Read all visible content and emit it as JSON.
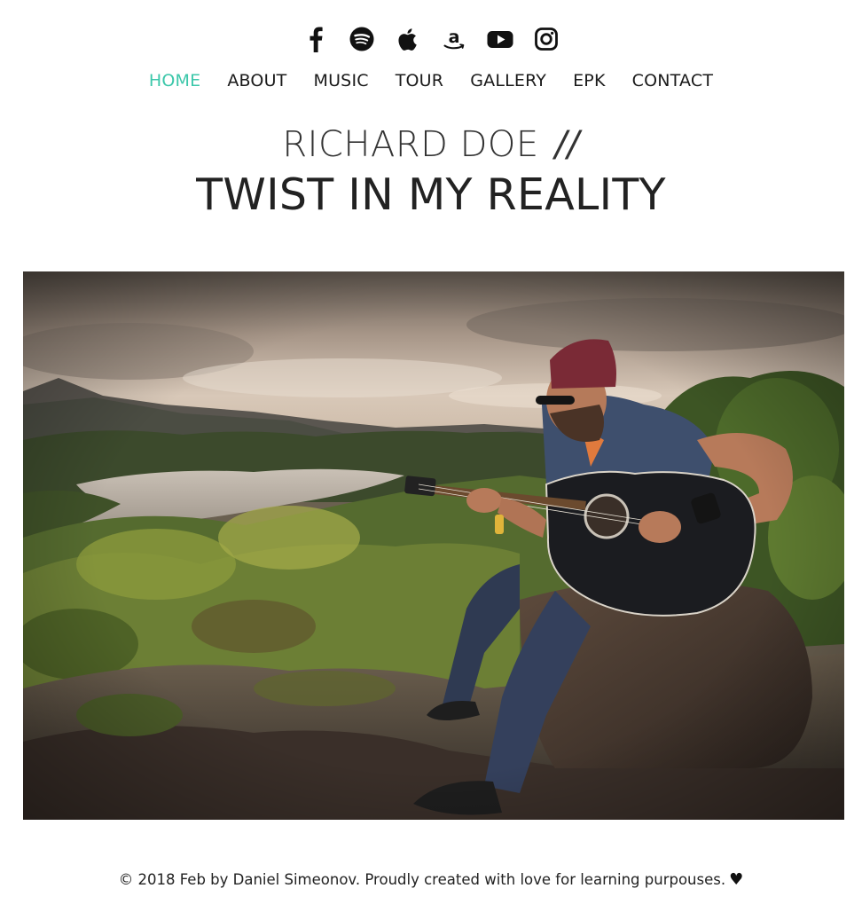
{
  "social": [
    {
      "name": "facebook-icon"
    },
    {
      "name": "spotify-icon"
    },
    {
      "name": "apple-icon"
    },
    {
      "name": "amazon-icon"
    },
    {
      "name": "youtube-icon"
    },
    {
      "name": "instagram-icon"
    }
  ],
  "nav": {
    "items": [
      {
        "label": "HOME",
        "active": true
      },
      {
        "label": "ABOUT"
      },
      {
        "label": "MUSIC"
      },
      {
        "label": "TOUR"
      },
      {
        "label": "GALLERY"
      },
      {
        "label": "EPK"
      },
      {
        "label": "CONTACT"
      }
    ],
    "active_color": "#3cc7aa"
  },
  "header": {
    "artist": "RICHARD DOE",
    "separator": "//",
    "title": "TWIST IN MY REALITY"
  },
  "hero": {
    "description_icon": "guitarist-photo"
  },
  "footer": {
    "text": "© 2018 Feb by Daniel Simeonov. Proudly created with love for learning purpouses.",
    "heart": "♥"
  }
}
